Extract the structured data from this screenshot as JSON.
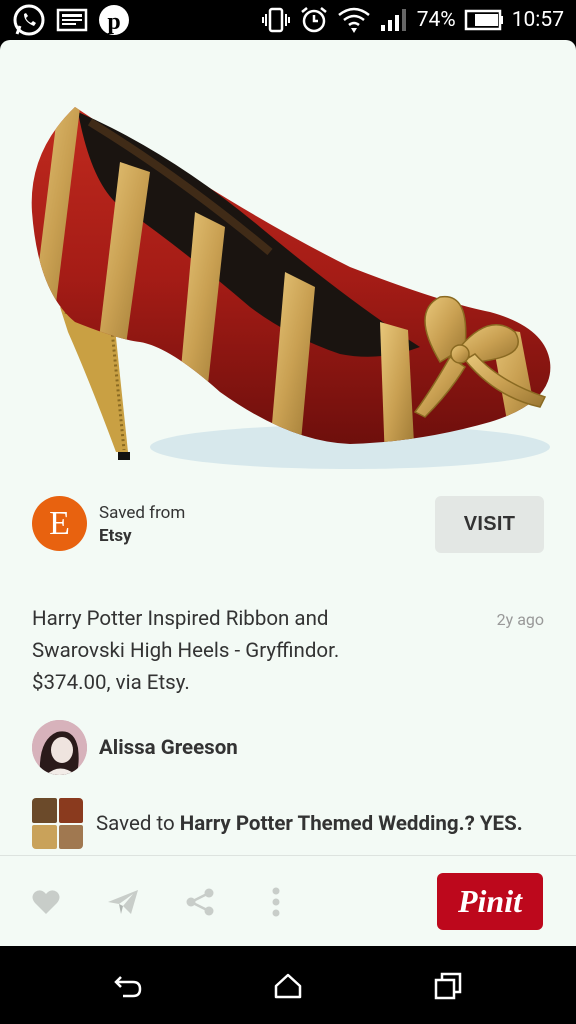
{
  "status_bar": {
    "battery": "74%",
    "time": "10:57"
  },
  "pin": {
    "image_desc": "red-and-gold-ribbon-high-heel-shoe",
    "source": {
      "saved_from_label": "Saved from",
      "name": "Etsy",
      "logo_letter": "E",
      "logo_color": "#e8620f"
    },
    "visit_label": "VISIT",
    "description_lines": [
      "Harry Potter Inspired Ribbon and",
      "Swarovski High Heels - Gryffindor.",
      "$374.00, via Etsy."
    ],
    "age": "2y ago",
    "pinner": {
      "name": "Alissa Greeson"
    },
    "board": {
      "prefix": "Saved to",
      "name": "Harry Potter Themed Wedding.? YES."
    }
  },
  "actions": {
    "pin_it_label": "Pinit",
    "pin_it_color": "#bd081c"
  }
}
